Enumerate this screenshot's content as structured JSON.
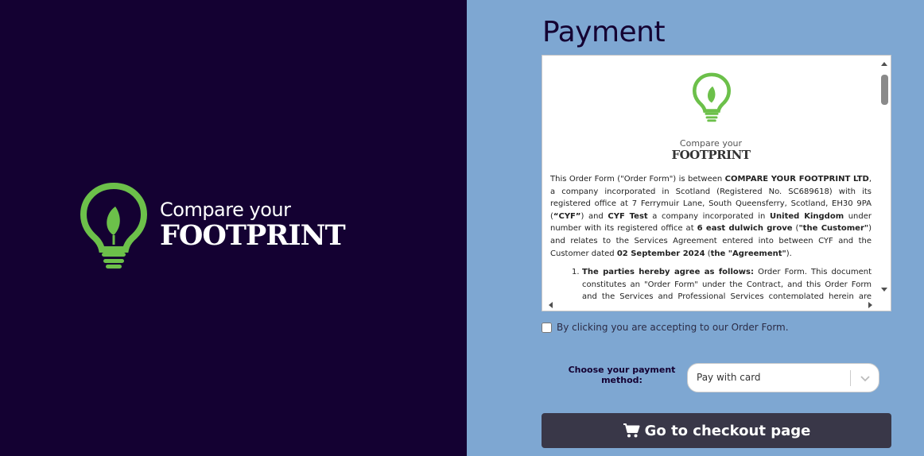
{
  "brand": {
    "line1": "Compare your",
    "line2": "FOOTPRINT",
    "colors": {
      "background": "#140132",
      "icon_green": "#6cc04a",
      "text": "#ffffff"
    },
    "icon": "lightbulb-leaf-icon"
  },
  "payment": {
    "title": "Payment",
    "document": {
      "logo_line1": "Compare your",
      "logo_line2": "FOOTPRINT",
      "intro": {
        "t1": "This Order Form (\"Order Form\") is between ",
        "b1": "COMPARE YOUR FOOTPRINT LTD",
        "t2": ", a company incorporated in Scotland (Registered No. SC689618) with its registered office at 7 Ferrymuir Lane, South Queensferry, Scotland, EH30 9PA (",
        "b2": "“CYF”",
        "t3": ") and ",
        "b3": "CYF Test",
        "t4": " a company incorporated in ",
        "b4": "United Kingdom",
        "t5": " under number with its registered office at ",
        "b5": "6 east dulwich grove",
        "t6": " (",
        "b6": "\"the Customer\"",
        "t7": ") and relates to the Services Agreement entered into between CYF and the Customer dated ",
        "b7": "02 September 2024",
        "t8": " (",
        "b8": "the \"Agreement\"",
        "t9": ")."
      },
      "clause1": {
        "num": "1.",
        "heading": "The parties hereby agree as follows:",
        "text": " Order Form. This document constitutes an \"Order Form\" under the Contract, and this Order Form and the Services and Professional Services contemplated herein are subject to the terms of the Agreement."
      }
    },
    "accept_label": "By clicking you are accepting to our Order Form.",
    "method_label": "Choose your payment method:",
    "method_value": "Pay with card",
    "checkout_label": "Go to checkout page",
    "checkout_icon": "cart-icon",
    "colors": {
      "panel": "#7ea7d2",
      "button": "#393748",
      "title": "#140132"
    }
  }
}
